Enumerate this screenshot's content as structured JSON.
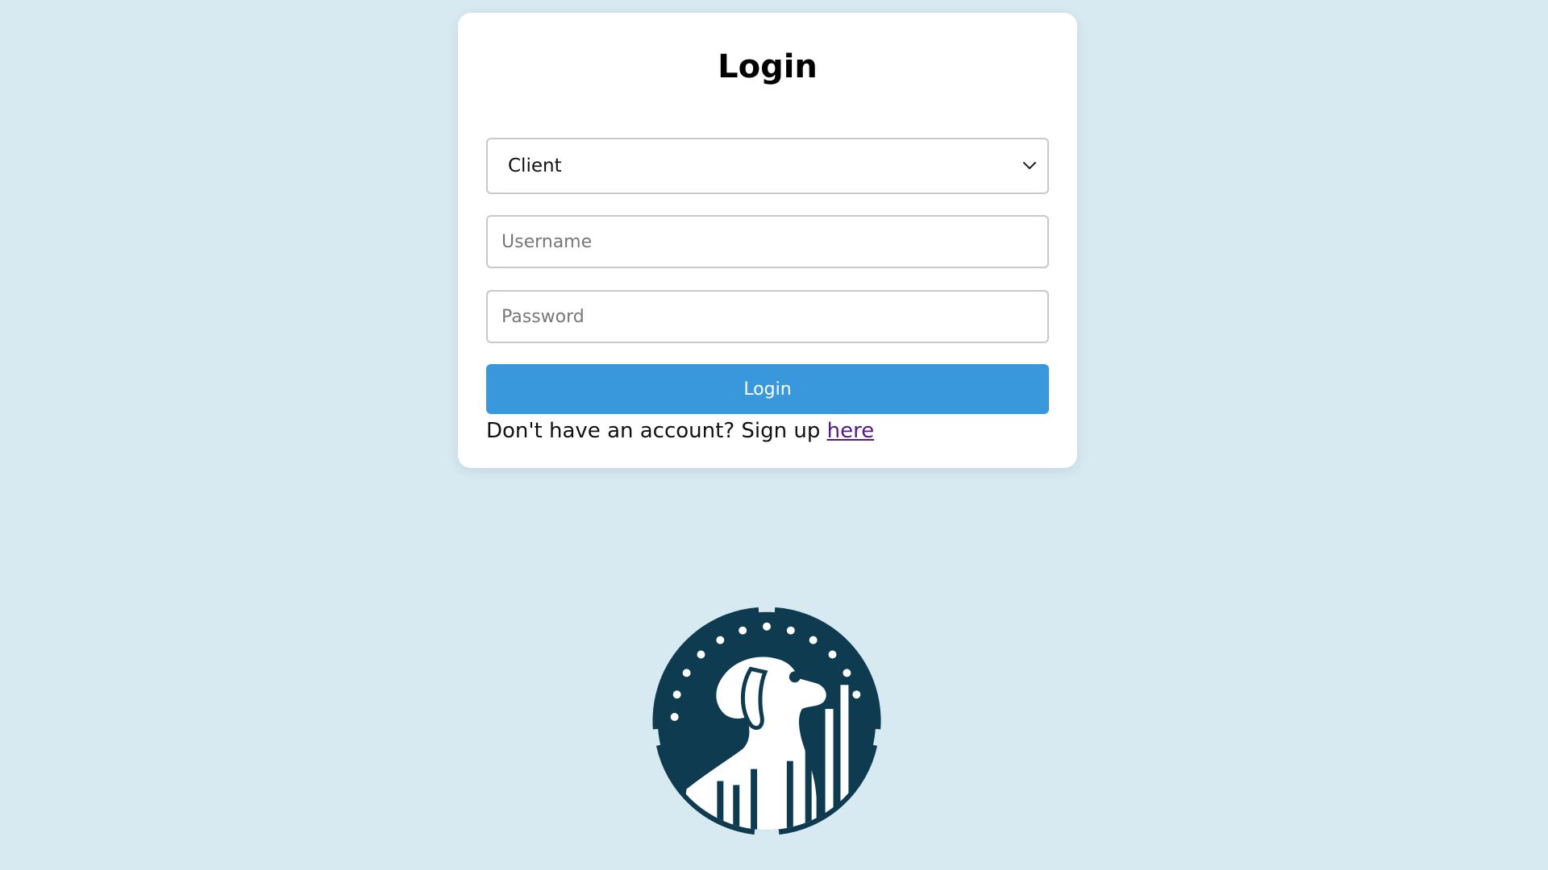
{
  "login_card": {
    "title": "Login",
    "role_select": {
      "selected": "Client"
    },
    "username": {
      "placeholder": "Username",
      "value": ""
    },
    "password": {
      "placeholder": "Password",
      "value": ""
    },
    "login_button_label": "Login",
    "signup_prompt": "Don't have an account? Sign up",
    "signup_link_label": "here"
  },
  "icons": {
    "select": "chevron-down-icon",
    "logo": "dog-logo"
  },
  "colors": {
    "background": "#d7e9f1",
    "card": "#ffffff",
    "button": "#3898db",
    "link": "#551a8b",
    "logo_dark": "#0f3b50"
  }
}
